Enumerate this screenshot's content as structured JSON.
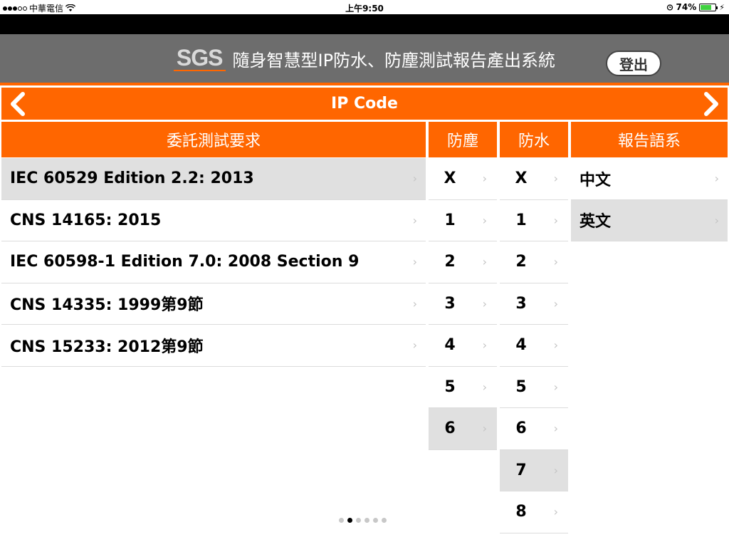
{
  "status_bar": {
    "carrier": "中華電信",
    "time": "上午9:50",
    "battery_percent": "74%",
    "battery_level": 0.74,
    "icons": [
      "signal-dots",
      "wifi-icon",
      "alarm-icon",
      "battery-icon",
      "charging-icon"
    ]
  },
  "header": {
    "logo": "SGS",
    "title": "隨身智慧型IP防水、防塵測試報告產出系統",
    "logout_label": "登出"
  },
  "nav": {
    "title": "IP Code",
    "back_icon": "chevron-left-icon",
    "forward_icon": "chevron-right-icon"
  },
  "columns": {
    "requirement": "委託測試要求",
    "dust": "防塵",
    "water": "防水",
    "language": "報告語系"
  },
  "requirements": [
    {
      "label": "IEC 60529 Edition 2.2: 2013",
      "selected": true
    },
    {
      "label": "CNS 14165: 2015",
      "selected": false
    },
    {
      "label": "IEC 60598-1 Edition 7.0: 2008 Section 9",
      "selected": false
    },
    {
      "label": "CNS 14335: 1999第9節",
      "selected": false
    },
    {
      "label": "CNS 15233: 2012第9節",
      "selected": false
    }
  ],
  "dust_levels": [
    {
      "label": "X",
      "selected": false
    },
    {
      "label": "1",
      "selected": false
    },
    {
      "label": "2",
      "selected": false
    },
    {
      "label": "3",
      "selected": false
    },
    {
      "label": "4",
      "selected": false
    },
    {
      "label": "5",
      "selected": false
    },
    {
      "label": "6",
      "selected": true
    }
  ],
  "water_levels": [
    {
      "label": "X",
      "selected": false
    },
    {
      "label": "1",
      "selected": false
    },
    {
      "label": "2",
      "selected": false
    },
    {
      "label": "3",
      "selected": false
    },
    {
      "label": "4",
      "selected": false
    },
    {
      "label": "5",
      "selected": false
    },
    {
      "label": "6",
      "selected": false
    },
    {
      "label": "7",
      "selected": true
    },
    {
      "label": "8",
      "selected": false
    }
  ],
  "languages": [
    {
      "label": "中文",
      "selected": false
    },
    {
      "label": "英文",
      "selected": true
    }
  ],
  "pagination": {
    "count": 6,
    "active": 1
  },
  "colors": {
    "accent": "#ff6600",
    "header_bg": "#6d6d6d",
    "selected_row": "#e0e0e0"
  }
}
